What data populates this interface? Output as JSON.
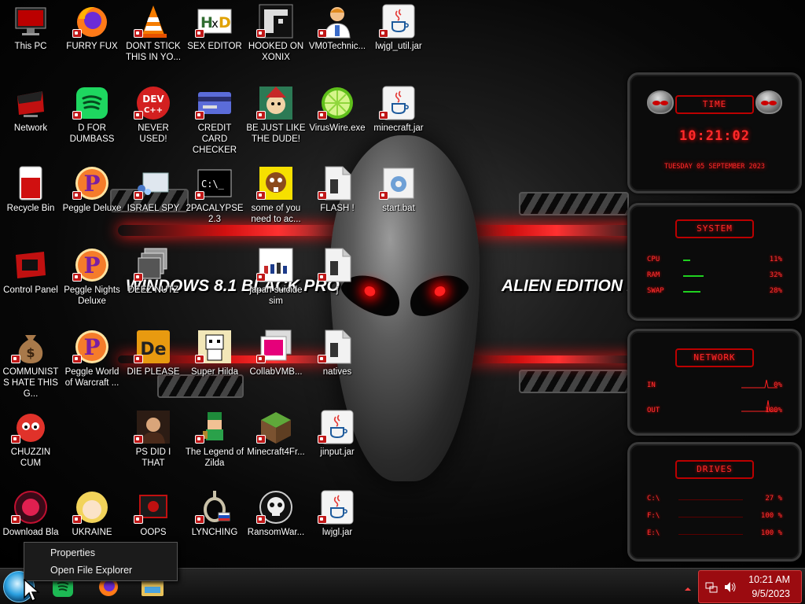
{
  "wallpaper": {
    "text_left": "WINDOWS 8.1 BLACK PRO",
    "text_right": "ALIEN EDITION 20"
  },
  "desktop_icons": [
    {
      "label": "This PC",
      "icon": "monitor-icon"
    },
    {
      "label": "FURRY FUX",
      "icon": "firefox-icon"
    },
    {
      "label": "DONT STICK THIS IN YO...",
      "icon": "vlc-cone-icon"
    },
    {
      "label": "SEX EDITOR",
      "icon": "hxd-editor-icon"
    },
    {
      "label": "HOOKED ON XONIX",
      "icon": "xonix-game-icon"
    },
    {
      "label": "VM0Technic...",
      "icon": "doctor-person-icon"
    },
    {
      "label": "lwjgl_util.jar",
      "icon": "java-jar-icon"
    },
    {
      "label": "Network",
      "icon": "network-icon"
    },
    {
      "label": "D FOR DUMBASS",
      "icon": "spotify-icon"
    },
    {
      "label": "NEVER USED!",
      "icon": "devcpp-icon"
    },
    {
      "label": "CREDIT CARD CHECKER",
      "icon": "credit-card-icon"
    },
    {
      "label": "BE JUST LIKE THE DUDE!",
      "icon": "elf-character-icon"
    },
    {
      "label": "VirusWire.exe",
      "icon": "lime-icon"
    },
    {
      "label": "minecraft.jar",
      "icon": "java-jar-icon"
    },
    {
      "label": "Recycle Bin",
      "icon": "recycle-bin-icon"
    },
    {
      "label": "Peggle Deluxe",
      "icon": "peggle-icon"
    },
    {
      "label": "ISRAEL SPY",
      "icon": "spy-app-icon"
    },
    {
      "label": "2PACALYPSE 2.3",
      "icon": "terminal-icon"
    },
    {
      "label": "some of you need to ac...",
      "icon": "beaver-icon"
    },
    {
      "label": "FLASH !",
      "icon": "file-icon"
    },
    {
      "label": "start.bat",
      "icon": "batch-gear-icon"
    },
    {
      "label": "Control Panel",
      "icon": "control-panel-icon"
    },
    {
      "label": "Peggle Nights Deluxe",
      "icon": "peggle-icon"
    },
    {
      "label": "DEEZ NUTZ",
      "icon": "stacked-windows-icon"
    },
    {
      "label": "japan suicide sim",
      "icon": "game-file-icon"
    },
    {
      "label": "j",
      "icon": "file-icon"
    },
    {
      "label": "COMMUNISTS HATE THIS G...",
      "icon": "money-bag-icon"
    },
    {
      "label": "Peggle World of Warcraft ...",
      "icon": "peggle-icon"
    },
    {
      "label": "DIE PLEASE",
      "icon": "de-app-icon"
    },
    {
      "label": "Super Hilda",
      "icon": "pixel-character-icon"
    },
    {
      "label": "CollabVMB...",
      "icon": "collab-app-icon"
    },
    {
      "label": "natives",
      "icon": "file-icon"
    },
    {
      "label": "CHUZZIN CUM",
      "icon": "chuzzle-icon"
    },
    {
      "label": "PS DID I THAT",
      "icon": "portrait-icon"
    },
    {
      "label": "The Legend of Zilda",
      "icon": "zelda-character-icon"
    },
    {
      "label": "Minecraft4Fr...",
      "icon": "minecraft-block-icon"
    },
    {
      "label": "jinput.jar",
      "icon": "java-jar-icon"
    },
    {
      "label": "Download Bla",
      "icon": "download-orb-icon"
    },
    {
      "label": "UKRAINE",
      "icon": "cartoon-girl-icon"
    },
    {
      "label": "OOPS",
      "icon": "oops-app-icon"
    },
    {
      "label": "LYNCHING",
      "icon": "rope-icon"
    },
    {
      "label": "RansomWar...",
      "icon": "skull-icon"
    },
    {
      "label": "lwjgl.jar",
      "icon": "java-jar-icon"
    }
  ],
  "gadgets": {
    "time": {
      "title": "TIME",
      "time": "10:21:02",
      "date": "TUESDAY 05 SEPTEMBER 2023"
    },
    "system": {
      "title": "SYSTEM",
      "rows": [
        {
          "label": "CPU",
          "value": "11%",
          "level": 0.11
        },
        {
          "label": "RAM",
          "value": "32%",
          "level": 0.32
        },
        {
          "label": "SWAP",
          "value": "28%",
          "level": 0.28
        }
      ]
    },
    "network": {
      "title": "NETWORK",
      "rows": [
        {
          "label": "IN",
          "value": "0%"
        },
        {
          "label": "OUT",
          "value": "100%"
        }
      ]
    },
    "drives": {
      "title": "DRIVES",
      "rows": [
        {
          "label": "C:\\",
          "value": "27 %"
        },
        {
          "label": "F:\\",
          "value": "100 %"
        },
        {
          "label": "E:\\",
          "value": "100 %"
        }
      ]
    }
  },
  "context_menu": {
    "items": [
      "Properties",
      "Open File Explorer"
    ]
  },
  "taskbar": {
    "apps": [
      {
        "icon": "spotify-icon"
      },
      {
        "icon": "firefox-icon"
      },
      {
        "icon": "file-explorer-icon"
      }
    ],
    "clock_time": "10:21 AM",
    "clock_date": "9/5/2023"
  }
}
